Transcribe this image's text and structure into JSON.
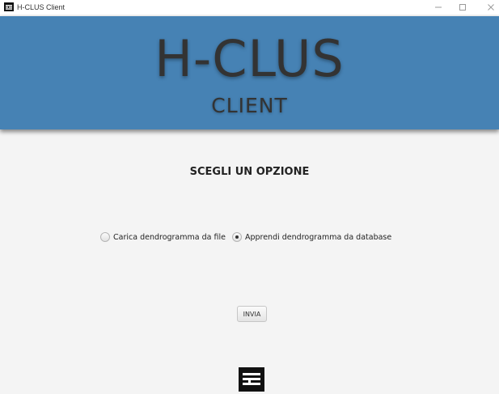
{
  "window": {
    "title": "H-CLUS Client"
  },
  "banner": {
    "title": "H-CLUS",
    "subtitle": "CLIENT"
  },
  "main": {
    "heading": "SCEGLI UN OPZIONE",
    "options": [
      {
        "label": "Carica dendrogramma da file",
        "selected": false
      },
      {
        "label": "Apprendi dendrogramma da database",
        "selected": true
      }
    ],
    "submit_label": "INVIA"
  },
  "icons": {
    "app": "igc-logo-icon",
    "footer": "igc-logo-icon"
  },
  "colors": {
    "banner": "#4682b4",
    "background": "#f4f4f4",
    "text": "#333333"
  }
}
